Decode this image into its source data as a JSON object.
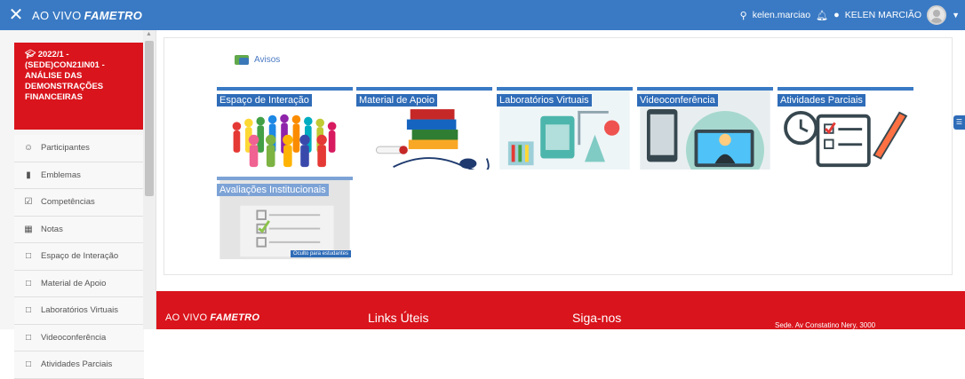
{
  "header": {
    "brand_prefix": "AO VIVO",
    "brand_name": "FAMETRO",
    "username": "kelen.marciao",
    "display_name": "KELEN MARCIÃO"
  },
  "sidebar": {
    "course_title": "2022/1 - (SEDE)CON21IN01 - ANÁLISE DAS DEMONSTRAÇÕES FINANCEIRAS",
    "items": [
      {
        "label": "Participantes",
        "icon": "users-icon"
      },
      {
        "label": "Emblemas",
        "icon": "shield-icon"
      },
      {
        "label": "Competências",
        "icon": "checkbox-icon"
      },
      {
        "label": "Notas",
        "icon": "table-icon"
      },
      {
        "label": "Espaço de Interação",
        "icon": "folder-icon"
      },
      {
        "label": "Material de Apoio",
        "icon": "folder-icon"
      },
      {
        "label": "Laboratórios Virtuais",
        "icon": "folder-icon"
      },
      {
        "label": "Videoconferência",
        "icon": "folder-icon"
      },
      {
        "label": "Atividades Parciais",
        "icon": "folder-icon"
      }
    ]
  },
  "main": {
    "avisos_label": "Avisos",
    "tiles": [
      {
        "label": "Espaço de Interação"
      },
      {
        "label": "Material de Apoio"
      },
      {
        "label": "Laboratórios Virtuais"
      },
      {
        "label": "Videoconferência"
      },
      {
        "label": "Atividades Parciais"
      },
      {
        "label": "Avaliações Institucionais",
        "tag": "Oculto para estudantes"
      }
    ]
  },
  "footer": {
    "brand_prefix": "AO VIVO",
    "brand_name": "FAMETRO",
    "links_title": "Links Úteis",
    "social_title": "Siga-nos",
    "address": "Sede. Av Constatino Nery, 3000"
  }
}
